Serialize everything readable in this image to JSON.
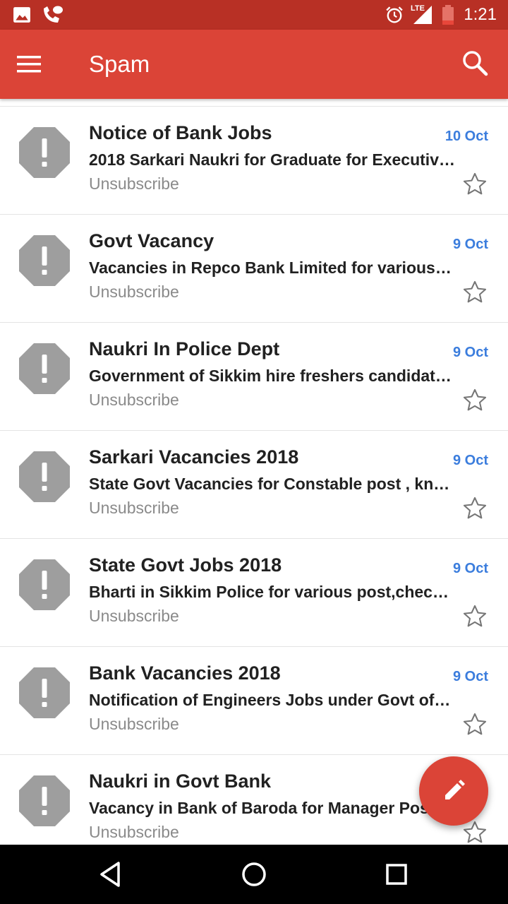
{
  "status_bar": {
    "time": "1:21",
    "network": "LTE",
    "icons": [
      "image-icon",
      "missed-call-icon",
      "alarm-icon",
      "signal-icon",
      "battery-icon"
    ]
  },
  "app_bar": {
    "title": "Spam",
    "icons": [
      "menu-icon",
      "search-icon"
    ],
    "color": "#db4437"
  },
  "emails": [
    {
      "sender": "Notice of Bank Jobs",
      "date": "10 Oct",
      "subject": "2018 Sarkari Naukri for Graduate for Executiv…",
      "action": "Unsubscribe"
    },
    {
      "sender": "Govt Vacancy",
      "date": "9 Oct",
      "subject": "Vacancies in Repco Bank Limited for various…",
      "action": "Unsubscribe"
    },
    {
      "sender": "Naukri In Police Dept",
      "date": "9 Oct",
      "subject": "Government of Sikkim hire freshers candidat…",
      "action": "Unsubscribe"
    },
    {
      "sender": "Sarkari Vacancies 2018",
      "date": "9 Oct",
      "subject": "State Govt Vacancies for Constable post , kn…",
      "action": "Unsubscribe"
    },
    {
      "sender": "State Govt Jobs 2018",
      "date": "9 Oct",
      "subject": "Bharti in Sikkim Police for various post,check…",
      "action": "Unsubscribe"
    },
    {
      "sender": "Bank Vacancies 2018",
      "date": "9 Oct",
      "subject": "Notification of Engineers Jobs under Govt of…",
      "action": "Unsubscribe"
    },
    {
      "sender": "Naukri in Govt Bank",
      "date": "",
      "subject": "Vacancy in Bank of Baroda for Manager Post",
      "action": "Unsubscribe"
    }
  ],
  "fab": {
    "icon": "pencil-icon",
    "color": "#db4437"
  },
  "nav_bar": {
    "icons": [
      "back-icon",
      "home-icon",
      "recents-icon"
    ]
  },
  "colors": {
    "date_blue": "#3b7ddd",
    "badge_gray": "#9e9e9e",
    "status_bar": "#b83025"
  }
}
